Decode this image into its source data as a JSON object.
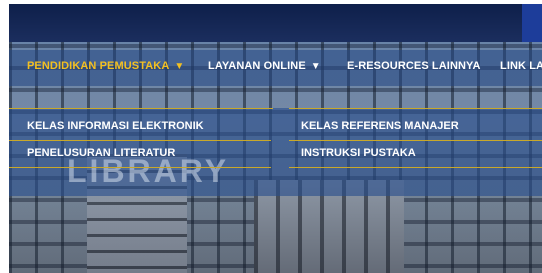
{
  "nav": {
    "items": [
      {
        "label": "PENDIDIKAN PEMUSTAKA",
        "arrow": "▼",
        "active": true
      },
      {
        "label": "LAYANAN ONLINE",
        "arrow": "▼",
        "active": false
      },
      {
        "label": "E-RESOURCES LAINNYA",
        "arrow": "",
        "active": false
      },
      {
        "label": "LINK LA",
        "arrow": "",
        "active": false
      }
    ]
  },
  "dropdown": {
    "left": [
      "KELAS INFORMASI ELEKTRONIK",
      "PENELUSURAN LITERATUR"
    ],
    "right": [
      "KELAS REFERENS MANAJER",
      "INSTRUKSI PUSTAKA"
    ]
  },
  "background": {
    "watermark": "LIBRARY"
  },
  "colors": {
    "active_nav": "#f3c021",
    "nav_text": "#ffffff",
    "divider": "#c9a92a"
  }
}
